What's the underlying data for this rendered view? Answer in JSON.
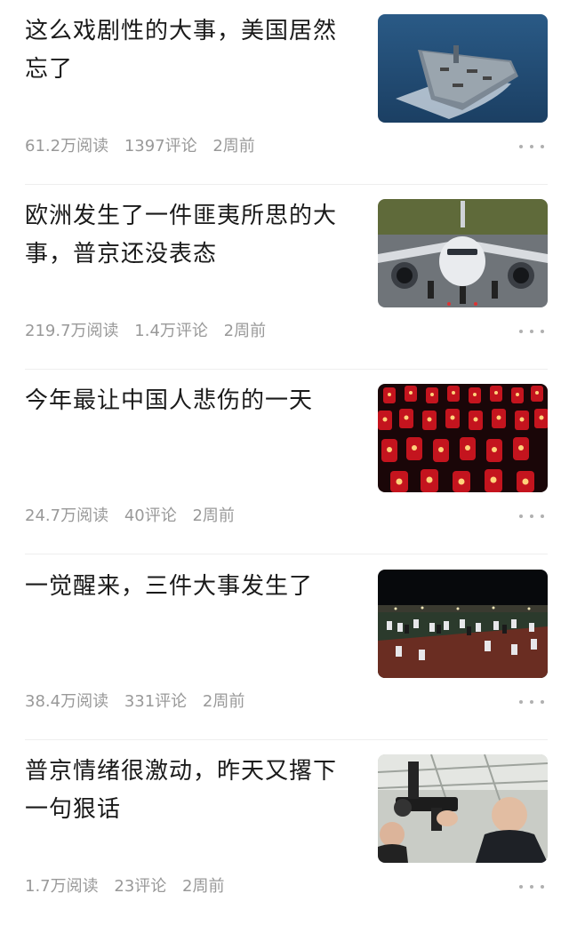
{
  "feed": {
    "items": [
      {
        "title": "这么戏剧性的大事，美国居然忘了",
        "reads": "61.2万阅读",
        "comments": "1397评论",
        "time": "2周前",
        "thumb_icon": "aircraft-carrier-image"
      },
      {
        "title": "欧洲发生了一件匪夷所思的大事，普京还没表态",
        "reads": "219.7万阅读",
        "comments": "1.4万评论",
        "time": "2周前",
        "thumb_icon": "airplane-image"
      },
      {
        "title": "今年最让中国人悲伤的一天",
        "reads": "24.7万阅读",
        "comments": "40评论",
        "time": "2周前",
        "thumb_icon": "candles-image"
      },
      {
        "title": "一觉醒来，三件大事发生了",
        "reads": "38.4万阅读",
        "comments": "331评论",
        "time": "2周前",
        "thumb_icon": "crowd-at-night-image"
      },
      {
        "title": "普京情绪很激动，昨天又撂下一句狠话",
        "reads": "1.7万阅读",
        "comments": "23评论",
        "time": "2周前",
        "thumb_icon": "man-with-gun-image"
      }
    ]
  },
  "colors": {
    "title": "#1a1a1a",
    "meta": "#999999",
    "divider": "#eeeeee",
    "more_dots": "#b0b0b0"
  }
}
